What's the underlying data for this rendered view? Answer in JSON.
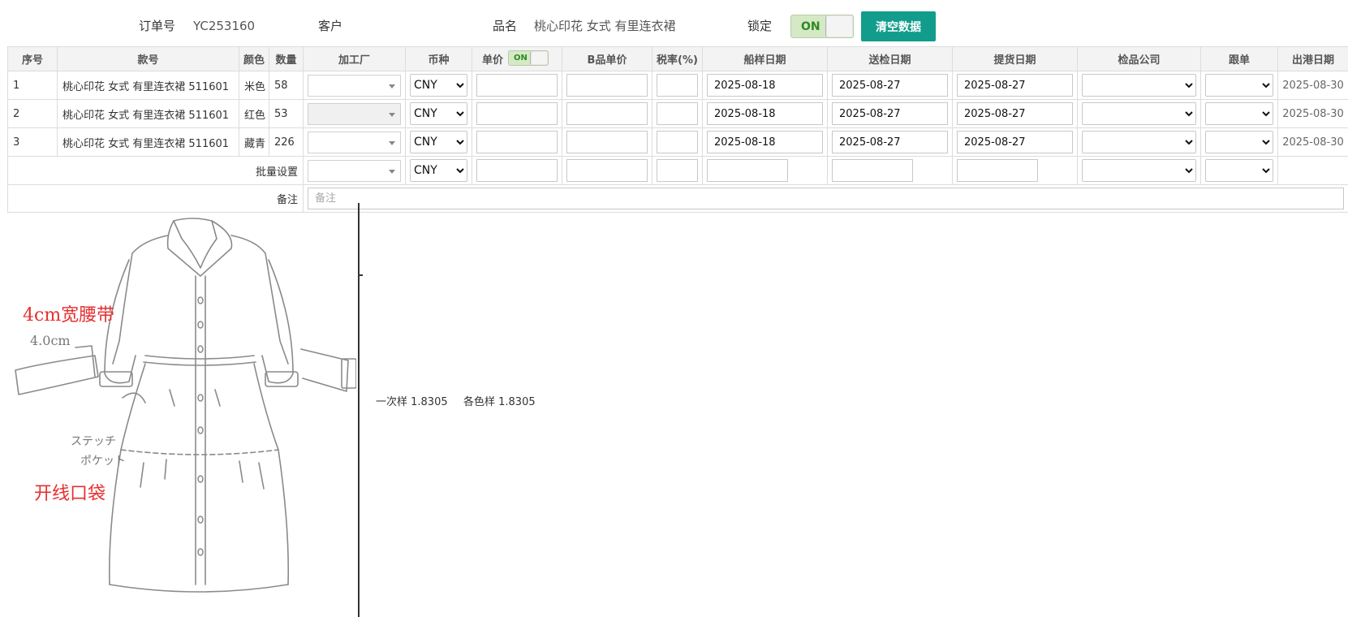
{
  "header": {
    "order_label": "订单号",
    "order_value": "YC253160",
    "customer_label": "客户",
    "customer_value": "",
    "product_label": "品名",
    "product_value": "桃心印花 女式 有里连衣裙",
    "lock_label": "锁定",
    "lock_toggle": "ON",
    "clear_button": "清空数据"
  },
  "columns": {
    "seq": "序号",
    "style": "款号",
    "color": "颜色",
    "qty": "数量",
    "factory": "加工厂",
    "currency": "币种",
    "unit_price": "单价",
    "unit_price_toggle": "ON",
    "b_price": "B品单价",
    "tax": "税率(%)",
    "ship_sample_date": "船样日期",
    "inspection_date": "送检日期",
    "pickup_date": "提货日期",
    "inspection_company": "检品公司",
    "follow_up": "跟单",
    "departure_date": "出港日期"
  },
  "rows": [
    {
      "seq": "1",
      "style": "桃心印花 女式 有里连衣裙 511601",
      "color": "米色",
      "qty": "58",
      "currency": "CNY",
      "ship_sample_date": "2025-08-18",
      "inspection_date": "2025-08-27",
      "pickup_date": "2025-08-27",
      "departure_date": "2025-08-30"
    },
    {
      "seq": "2",
      "style": "桃心印花 女式 有里连衣裙 511601",
      "color": "红色",
      "qty": "53",
      "currency": "CNY",
      "ship_sample_date": "2025-08-18",
      "inspection_date": "2025-08-27",
      "pickup_date": "2025-08-27",
      "departure_date": "2025-08-30"
    },
    {
      "seq": "3",
      "style": "桃心印花 女式 有里连衣裙 511601",
      "color": "藏青",
      "qty": "226",
      "currency": "CNY",
      "ship_sample_date": "2025-08-18",
      "inspection_date": "2025-08-27",
      "pickup_date": "2025-08-27",
      "departure_date": "2025-08-30"
    }
  ],
  "batch": {
    "label": "批量设置",
    "currency": "CNY"
  },
  "memo": {
    "label": "备注",
    "placeholder": "备注"
  },
  "sketch": {
    "annotation_waistband": "4cm宽腰带",
    "annotation_pocket": "开线口袋",
    "handwriting_1": "4.0cm",
    "handwriting_2": "ステッチ",
    "handwriting_3": "ポケット"
  },
  "samples": {
    "first_sample": "一次样 1.8305",
    "color_sample": "各色样 1.8305"
  },
  "colors": {
    "accent": "#129c8c",
    "toggle_on": "#d5e9c6",
    "annotation_red": "#e53030"
  }
}
